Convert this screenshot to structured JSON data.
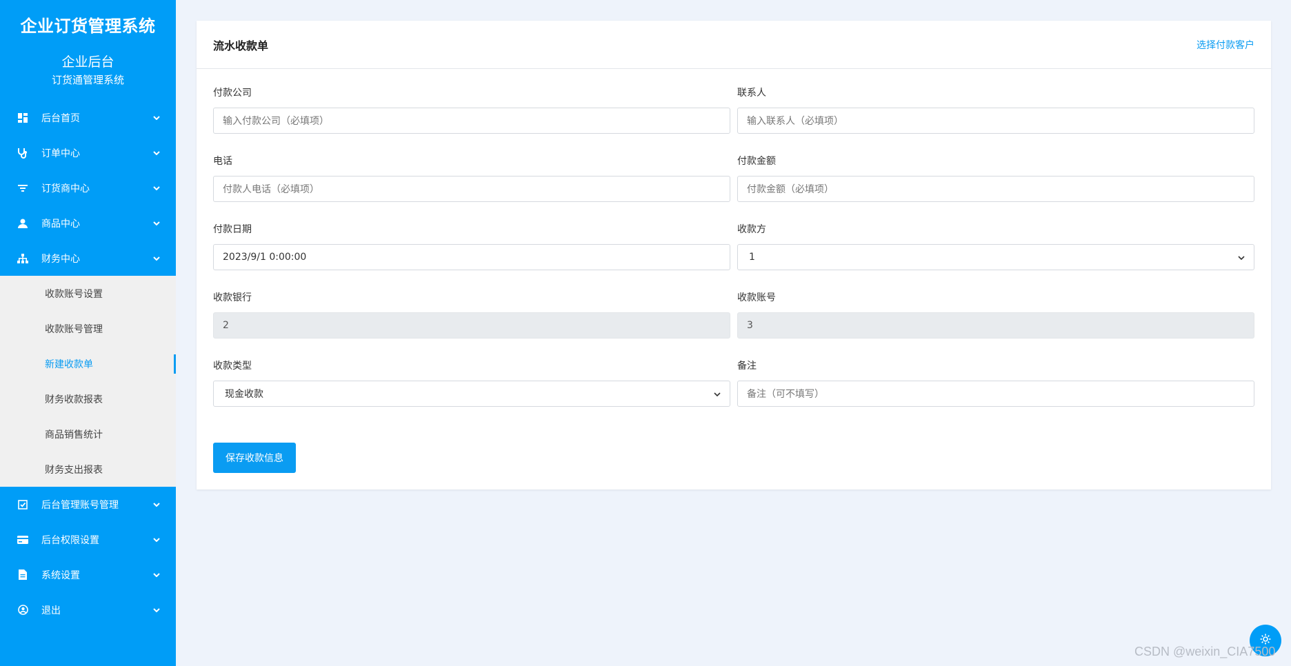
{
  "sidebar": {
    "brand": "企业订货管理系统",
    "subtitle1": "企业后台",
    "subtitle2": "订货通管理系统",
    "items": [
      {
        "label": "后台首页",
        "icon": "dashboard-icon"
      },
      {
        "label": "订单中心",
        "icon": "stethoscope-icon"
      },
      {
        "label": "订货商中心",
        "icon": "filter-icon"
      },
      {
        "label": "商品中心",
        "icon": "user-icon"
      },
      {
        "label": "财务中心",
        "icon": "sitemap-icon"
      }
    ],
    "finance_sub": [
      {
        "label": "收款账号设置"
      },
      {
        "label": "收款账号管理"
      },
      {
        "label": "新建收款单"
      },
      {
        "label": "财务收款报表"
      },
      {
        "label": "商品销售统计"
      },
      {
        "label": "财务支出报表"
      }
    ],
    "items_after": [
      {
        "label": "后台管理账号管理",
        "icon": "checkbox-icon"
      },
      {
        "label": "后台权限设置",
        "icon": "card-icon"
      },
      {
        "label": "系统设置",
        "icon": "document-icon"
      },
      {
        "label": "退出",
        "icon": "user-circle-icon"
      }
    ]
  },
  "card": {
    "title": "流水收款单",
    "link": "选择付款客户"
  },
  "form": {
    "payer_company": {
      "label": "付款公司",
      "placeholder": "输入付款公司（必填项）"
    },
    "contact": {
      "label": "联系人",
      "placeholder": "输入联系人（必填项）"
    },
    "phone": {
      "label": "电话",
      "placeholder": "付款人电话（必填项）"
    },
    "amount": {
      "label": "付款金额",
      "placeholder": "付款金额（必填项）"
    },
    "pay_date": {
      "label": "付款日期",
      "value": "2023/9/1 0:00:00"
    },
    "receiver": {
      "label": "收款方",
      "value": "1"
    },
    "bank": {
      "label": "收款银行",
      "value": "2"
    },
    "account": {
      "label": "收款账号",
      "value": "3"
    },
    "type": {
      "label": "收款类型",
      "value": "现金收款"
    },
    "remark": {
      "label": "备注",
      "placeholder": "备注（可不填写）"
    }
  },
  "save_button": "保存收款信息",
  "watermark": "CSDN @weixin_CIA7500"
}
